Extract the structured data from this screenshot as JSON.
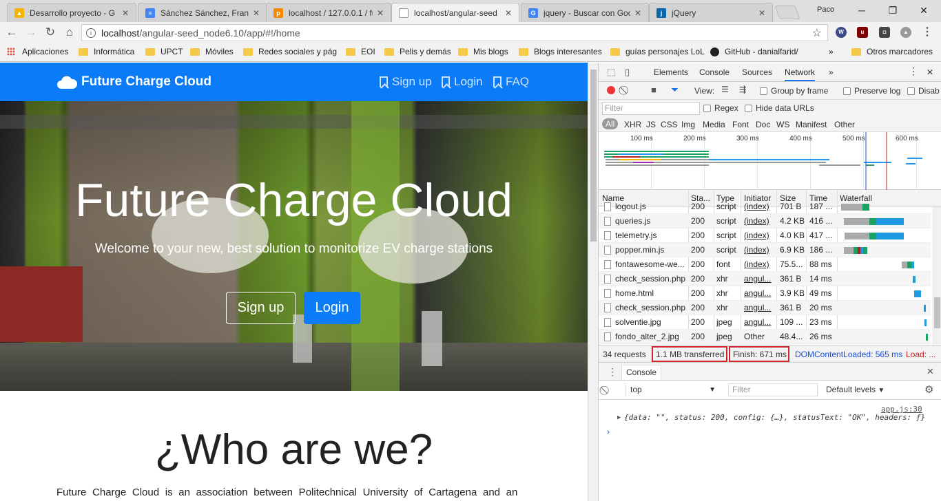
{
  "browser": {
    "tabs": [
      {
        "label": "Desarrollo proyecto - G",
        "favicon": "drive-icon",
        "color": "#f4b400"
      },
      {
        "label": "Sánchez Sánchez, Franc",
        "favicon": "docs-icon",
        "color": "#4285f4"
      },
      {
        "label": "localhost / 127.0.0.1 / fu",
        "favicon": "phpmyadmin-icon",
        "color": "#f58a00"
      },
      {
        "label": "localhost/angular-seed",
        "favicon": "page-icon",
        "color": "#999999"
      },
      {
        "label": "jquery - Buscar con Goo",
        "favicon": "google-icon",
        "color": "#4285f4"
      },
      {
        "label": "jQuery",
        "favicon": "jquery-icon",
        "color": "#0769ad"
      }
    ],
    "user": "Paco",
    "url_host": "localhost",
    "url_path": "/angular-seed_node6.10/app/#!/home",
    "bookmarks": [
      "Aplicaciones",
      "Informática",
      "UPCT",
      "Móviles",
      "Redes sociales y pág",
      "EOI",
      "Pelis y demás",
      "Mis blogs",
      "Blogs interesantes",
      "guías personajes LoL",
      "GitHub - danialfarid/",
      "»",
      "Otros marcadores"
    ]
  },
  "site": {
    "brand": "Future Charge Cloud",
    "nav": [
      "Sign up",
      "Login",
      "FAQ"
    ],
    "hero_title": "Future Charge Cloud",
    "hero_subtitle": "Welcome to your new, best solution to monitorize EV charge stations",
    "btn_signup": "Sign up",
    "btn_login": "Login",
    "who_title": "¿Who are we?",
    "who_text": "Future Charge Cloud is an association between Politechnical University of Cartagena and an"
  },
  "devtools": {
    "tabs": [
      "Elements",
      "Console",
      "Sources",
      "Network"
    ],
    "active_tab": "Network",
    "toolbar": {
      "view": "View:",
      "group_by_frame": "Group by frame",
      "preserve_log": "Preserve log",
      "disable": "Disab"
    },
    "filter_placeholder": "Filter",
    "regex": "Regex",
    "hide_data_urls": "Hide data URLs",
    "types": [
      "All",
      "XHR",
      "JS",
      "CSS",
      "Img",
      "Media",
      "Font",
      "Doc",
      "WS",
      "Manifest",
      "Other"
    ],
    "overview_ticks": [
      "100 ms",
      "200 ms",
      "300 ms",
      "400 ms",
      "500 ms",
      "600 ms"
    ],
    "columns": [
      "Name",
      "Sta...",
      "Type",
      "Initiator",
      "Size",
      "Time",
      "Waterfall"
    ],
    "rows": [
      {
        "name": "logout.js",
        "status": "200",
        "type": "script",
        "initiator": "(index)",
        "size": "701 B",
        "time": "187 ..."
      },
      {
        "name": "queries.js",
        "status": "200",
        "type": "script",
        "initiator": "(index)",
        "size": "4.2 KB",
        "time": "416 ..."
      },
      {
        "name": "telemetry.js",
        "status": "200",
        "type": "script",
        "initiator": "(index)",
        "size": "4.0 KB",
        "time": "417 ..."
      },
      {
        "name": "popper.min.js",
        "status": "200",
        "type": "script",
        "initiator": "(index)",
        "size": "6.9 KB",
        "time": "186 ..."
      },
      {
        "name": "fontawesome-we...",
        "status": "200",
        "type": "font",
        "initiator": "(index)",
        "size": "75.5...",
        "time": "88 ms"
      },
      {
        "name": "check_session.php",
        "status": "200",
        "type": "xhr",
        "initiator": "angul...",
        "size": "361 B",
        "time": "14 ms"
      },
      {
        "name": "home.html",
        "status": "200",
        "type": "xhr",
        "initiator": "angul...",
        "size": "3.9 KB",
        "time": "49 ms"
      },
      {
        "name": "check_session.php",
        "status": "200",
        "type": "xhr",
        "initiator": "angul...",
        "size": "361 B",
        "time": "20 ms"
      },
      {
        "name": "solventie.jpg",
        "status": "200",
        "type": "jpeg",
        "initiator": "angul...",
        "size": "109 ...",
        "time": "23 ms"
      },
      {
        "name": "fondo_alter_2.jpg",
        "status": "200",
        "type": "jpeg",
        "initiator": "Other",
        "size": "48.4...",
        "time": "26 ms"
      }
    ],
    "summary": {
      "requests": "34 requests",
      "transferred": "1.1 MB transferred",
      "finish": "Finish: 671 ms",
      "dcl": "DOMContentLoaded: 565 ms",
      "load": "Load: ..."
    },
    "console": {
      "tab": "Console",
      "context": "top",
      "filter_placeholder": "Filter",
      "levels": "Default levels",
      "source": "app.js:30",
      "log_line": "{data: \"\", status: 200, config: {…}, statusText: \"OK\", headers: ƒ}",
      "prompt": "›"
    }
  },
  "colors": {
    "brand_blue": "#0b7bf8",
    "highlight_red": "#d0272e",
    "dcl_blue": "#1a4fd6",
    "load_red": "#c5221f"
  }
}
